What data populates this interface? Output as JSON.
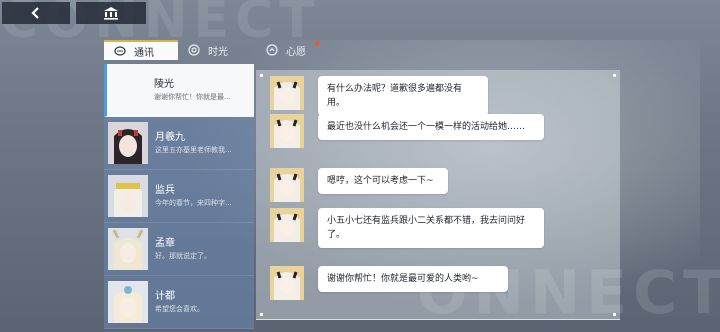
{
  "background": {
    "top_word": "CONNECT",
    "bottom_word": "ONNECT"
  },
  "toolbar": {
    "back_icon": "chevron-left-icon",
    "home_icon": "building-icon"
  },
  "tabs": [
    {
      "label": "通讯",
      "icon": "chat-bubble-icon",
      "active": true
    },
    {
      "label": "时光",
      "icon": "camera-icon",
      "active": false
    },
    {
      "label": "心愿",
      "icon": "wish-icon",
      "active": false,
      "badge": true
    }
  ],
  "contacts": [
    {
      "name": "陵光",
      "preview": "谢谢你帮忙！你就是最..."
    },
    {
      "name": "月羲九",
      "preview": "这里五亦基里老师教我..."
    },
    {
      "name": "监兵",
      "preview": "今年的春节，来四种字..."
    },
    {
      "name": "孟章",
      "preview": "好。那就说定了。"
    },
    {
      "name": "计都",
      "preview": "希望您会喜欢。"
    }
  ],
  "messages": [
    {
      "text": "有什么办法呢？道歉很多遍都没有用。"
    },
    {
      "text": "最近也没什么机会还一个一模一样的活动给她……"
    },
    {
      "text": "嗯哼，这个可以考虑一下~"
    },
    {
      "text": "小五小七还有监兵跟小二关系都不错，我去问问好了。"
    },
    {
      "text": "谢谢你帮忙！你就是最可爱的人类哟~"
    }
  ],
  "colors": {
    "accent_gold": "#d7b446",
    "badge": "#e85b2a",
    "active_marker": "#4a9be0"
  }
}
